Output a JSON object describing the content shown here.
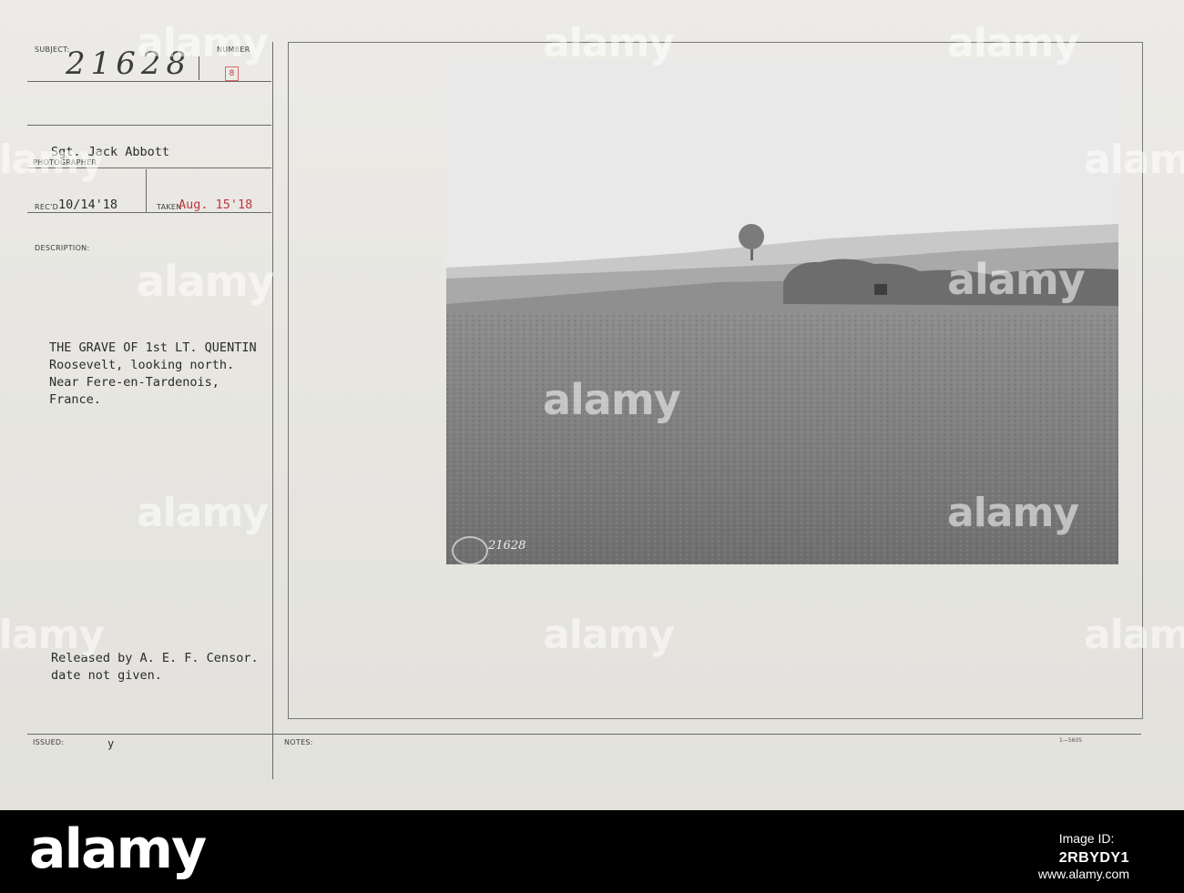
{
  "card": {
    "labels": {
      "subject": "SUBJECT:",
      "number": "NUMBER",
      "photographer": "PHOTOGRAPHER",
      "recd": "REC'D",
      "taken": "TAKEN",
      "description": "DESCRIPTION:",
      "issued": "ISSUED:",
      "notes": "NOTES:"
    },
    "subject_number": "21628",
    "number_stamp": "8",
    "photographer": "Sgt. Jack Abbott",
    "recd_date": "10/14'18",
    "taken_date": "Aug. 15'18",
    "description": [
      "THE GRAVE OF 1st LT. QUENTIN",
      "Roosevelt, looking north.",
      "Near Fere-en-Tardenois,",
      "France."
    ],
    "release_note": [
      "Released by A. E. F. Censor.",
      "date not given."
    ],
    "issued_mark": "y",
    "form_code": "1—5605",
    "photo_negative_number": "21628"
  },
  "watermark": "alamy",
  "footer": {
    "brand": "alamy",
    "image_id_label": "Image ID:",
    "image_id": "2RBYDY1",
    "url": "www.alamy.com"
  }
}
